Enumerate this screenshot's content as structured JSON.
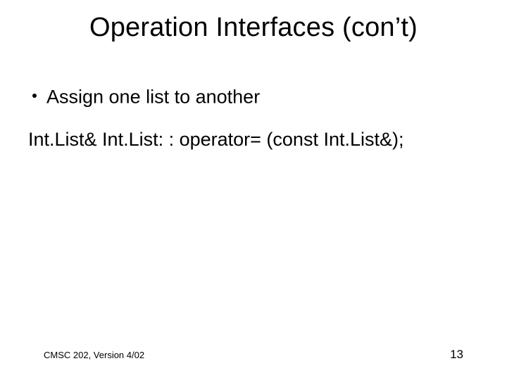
{
  "slide": {
    "title": "Operation Interfaces (con’t)",
    "bullet1": "Assign one list to another",
    "code1": "Int.List& Int.List: : operator= (const Int.List&);",
    "footer_left": "CMSC 202, Version 4/02",
    "page_number": "13"
  }
}
